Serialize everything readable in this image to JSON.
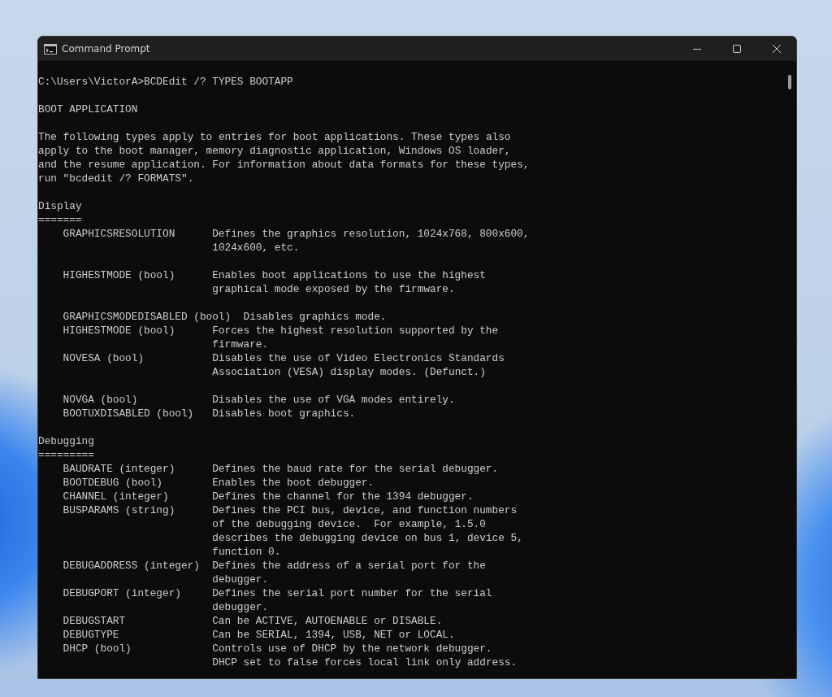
{
  "window": {
    "title": "Command Prompt"
  },
  "blocks": [
    {
      "lines": [
        {
          "kind": "text",
          "text": "C:\\Users\\VictorA>BCDEdit /? TYPES BOOTAPP"
        }
      ]
    },
    {
      "lines": [
        {
          "kind": "text",
          "text": "BOOT APPLICATION"
        }
      ]
    },
    {
      "lines": [
        {
          "kind": "text",
          "text": "The following types apply to entries for boot applications. These types also"
        },
        {
          "kind": "text",
          "text": "apply to the boot manager, memory diagnostic application, Windows OS loader,"
        },
        {
          "kind": "text",
          "text": "and the resume application. For information about data formats for these types,"
        },
        {
          "kind": "text",
          "text": "run \"bcdedit /? FORMATS\"."
        }
      ]
    },
    {
      "lines": [
        {
          "kind": "text",
          "text": "Display"
        },
        {
          "kind": "rule",
          "text": "======="
        },
        {
          "kind": "entry",
          "name": "GRAPHICSRESOLUTION",
          "text": "Defines the graphics resolution, 1024x768, 800x600,"
        },
        {
          "kind": "continuation",
          "text": "1024x600, etc."
        }
      ]
    },
    {
      "lines": [
        {
          "kind": "entry",
          "name": "HIGHESTMODE (bool)",
          "text": "Enables boot applications to use the highest"
        },
        {
          "kind": "continuation",
          "text": "graphical mode exposed by the firmware."
        }
      ]
    },
    {
      "lines": [
        {
          "kind": "entry",
          "name": "GRAPHICSMODEDISABLED (bool)",
          "text": "Disables graphics mode."
        },
        {
          "kind": "entry",
          "name": "HIGHESTMODE (bool)",
          "text": "Forces the highest resolution supported by the"
        },
        {
          "kind": "continuation",
          "text": "firmware."
        },
        {
          "kind": "entry",
          "name": "NOVESA (bool)",
          "text": "Disables the use of Video Electronics Standards"
        },
        {
          "kind": "continuation",
          "text": "Association (VESA) display modes. (Defunct.)"
        }
      ]
    },
    {
      "lines": [
        {
          "kind": "entry",
          "name": "NOVGA (bool)",
          "text": "Disables the use of VGA modes entirely."
        },
        {
          "kind": "entry",
          "name": "BOOTUXDISABLED (bool)",
          "text": "Disables boot graphics."
        }
      ]
    },
    {
      "lines": [
        {
          "kind": "text",
          "text": "Debugging"
        },
        {
          "kind": "rule",
          "text": "========="
        },
        {
          "kind": "entry",
          "name": "BAUDRATE (integer)",
          "text": "Defines the baud rate for the serial debugger."
        },
        {
          "kind": "entry",
          "name": "BOOTDEBUG (bool)",
          "text": "Enables the boot debugger."
        },
        {
          "kind": "entry",
          "name": "CHANNEL (integer)",
          "text": "Defines the channel for the 1394 debugger."
        },
        {
          "kind": "entry",
          "name": "BUSPARAMS (string)",
          "text": "Defines the PCI bus, device, and function numbers"
        },
        {
          "kind": "continuation",
          "text": "of the debugging device.  For example, 1.5.0"
        },
        {
          "kind": "continuation",
          "text": "describes the debugging device on bus 1, device 5,"
        },
        {
          "kind": "continuation",
          "text": "function 0."
        },
        {
          "kind": "entry",
          "name": "DEBUGADDRESS (integer)",
          "text": "Defines the address of a serial port for the"
        },
        {
          "kind": "continuation",
          "text": "debugger."
        },
        {
          "kind": "entry",
          "name": "DEBUGPORT (integer)",
          "text": "Defines the serial port number for the serial"
        },
        {
          "kind": "continuation",
          "text": "debugger."
        },
        {
          "kind": "entry",
          "name": "DEBUGSTART",
          "text": "Can be ACTIVE, AUTOENABLE or DISABLE."
        },
        {
          "kind": "entry",
          "name": "DEBUGTYPE",
          "text": "Can be SERIAL, 1394, USB, NET or LOCAL."
        },
        {
          "kind": "entry",
          "name": "DHCP (bool)",
          "text": "Controls use of DHCP by the network debugger."
        },
        {
          "kind": "continuation",
          "text": "DHCP set to false forces local link only address."
        }
      ]
    }
  ]
}
